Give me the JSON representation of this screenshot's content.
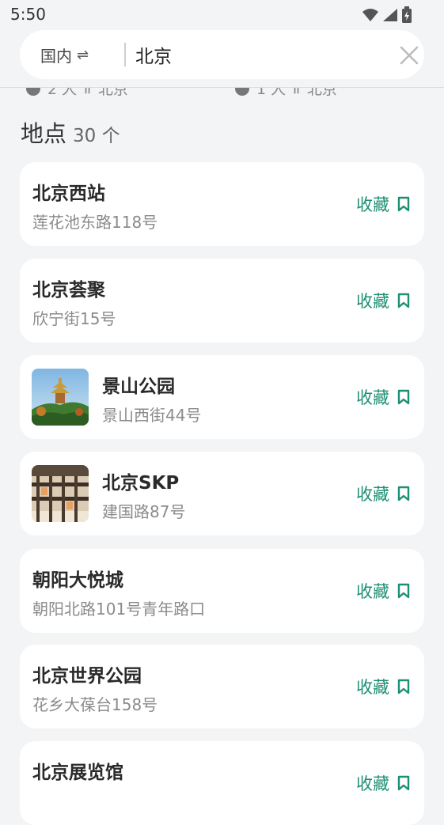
{
  "status": {
    "time": "5:50"
  },
  "search": {
    "scope_label": "国内",
    "swap_icon": "⇌",
    "query": "北京"
  },
  "peek": [
    {
      "count": "2 人",
      "place": "北京"
    },
    {
      "count": "1 人",
      "place": "北京"
    }
  ],
  "section": {
    "title": "地点",
    "count": "30 个"
  },
  "colors": {
    "accent": "#1f8f74",
    "background": "#f3f4f6"
  },
  "places": [
    {
      "name": "北京西站",
      "address": "莲花池东路118号",
      "thumb": "",
      "fav_label": "收藏"
    },
    {
      "name": "北京荟聚",
      "address": "欣宁街15号",
      "thumb": "",
      "fav_label": "收藏"
    },
    {
      "name": "景山公园",
      "address": "景山西街44号",
      "thumb": "park",
      "fav_label": "收藏"
    },
    {
      "name": "北京SKP",
      "address": "建国路87号",
      "thumb": "mall",
      "fav_label": "收藏"
    },
    {
      "name": "朝阳大悦城",
      "address": "朝阳北路101号青年路口",
      "thumb": "",
      "fav_label": "收藏"
    },
    {
      "name": "北京世界公园",
      "address": "花乡大葆台158号",
      "thumb": "",
      "fav_label": "收藏"
    },
    {
      "name": "北京展览馆",
      "address": "",
      "thumb": "",
      "fav_label": "收藏"
    }
  ]
}
